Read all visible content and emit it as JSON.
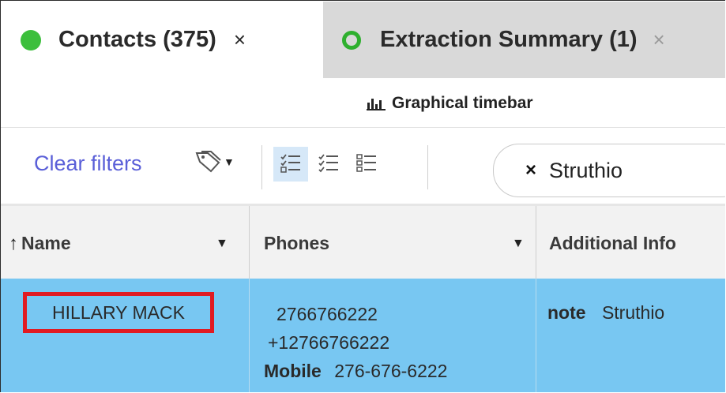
{
  "tabs": [
    {
      "label": "Contacts (375)",
      "close": "×",
      "state": "active",
      "status_color": "#3cbf3c"
    },
    {
      "label": "Extraction Summary (1)",
      "close": "×",
      "state": "inactive",
      "status_color": "#2fb02f"
    }
  ],
  "timebar": {
    "label": "Graphical timebar",
    "icon": "bar-chart-icon"
  },
  "toolbar": {
    "clear_filters": "Clear filters",
    "tag_filter_icon": "tag-icon",
    "view_modes": [
      "list-checked-view-icon",
      "list-partial-view-icon",
      "list-plain-view-icon"
    ],
    "selected_view": 0
  },
  "search": {
    "clear": "×",
    "term": "Struthio"
  },
  "table": {
    "columns": [
      {
        "label": "Name",
        "sort": "↑",
        "caret": "▼"
      },
      {
        "label": "Phones",
        "caret": "▼"
      },
      {
        "label": "Additional Info"
      }
    ],
    "rows": [
      {
        "name": "HILLARY MACK",
        "phones": [
          {
            "type": "",
            "number": "2766766222"
          },
          {
            "type": "",
            "number": "+12766766222"
          },
          {
            "type": "Mobile",
            "number": "276-676-6222"
          }
        ],
        "info": {
          "key": "note",
          "value": "Struthio"
        }
      }
    ]
  },
  "colors": {
    "selected_row": "#78c7f2",
    "highlight_box": "#e11b22",
    "link": "#5a5fd8"
  }
}
